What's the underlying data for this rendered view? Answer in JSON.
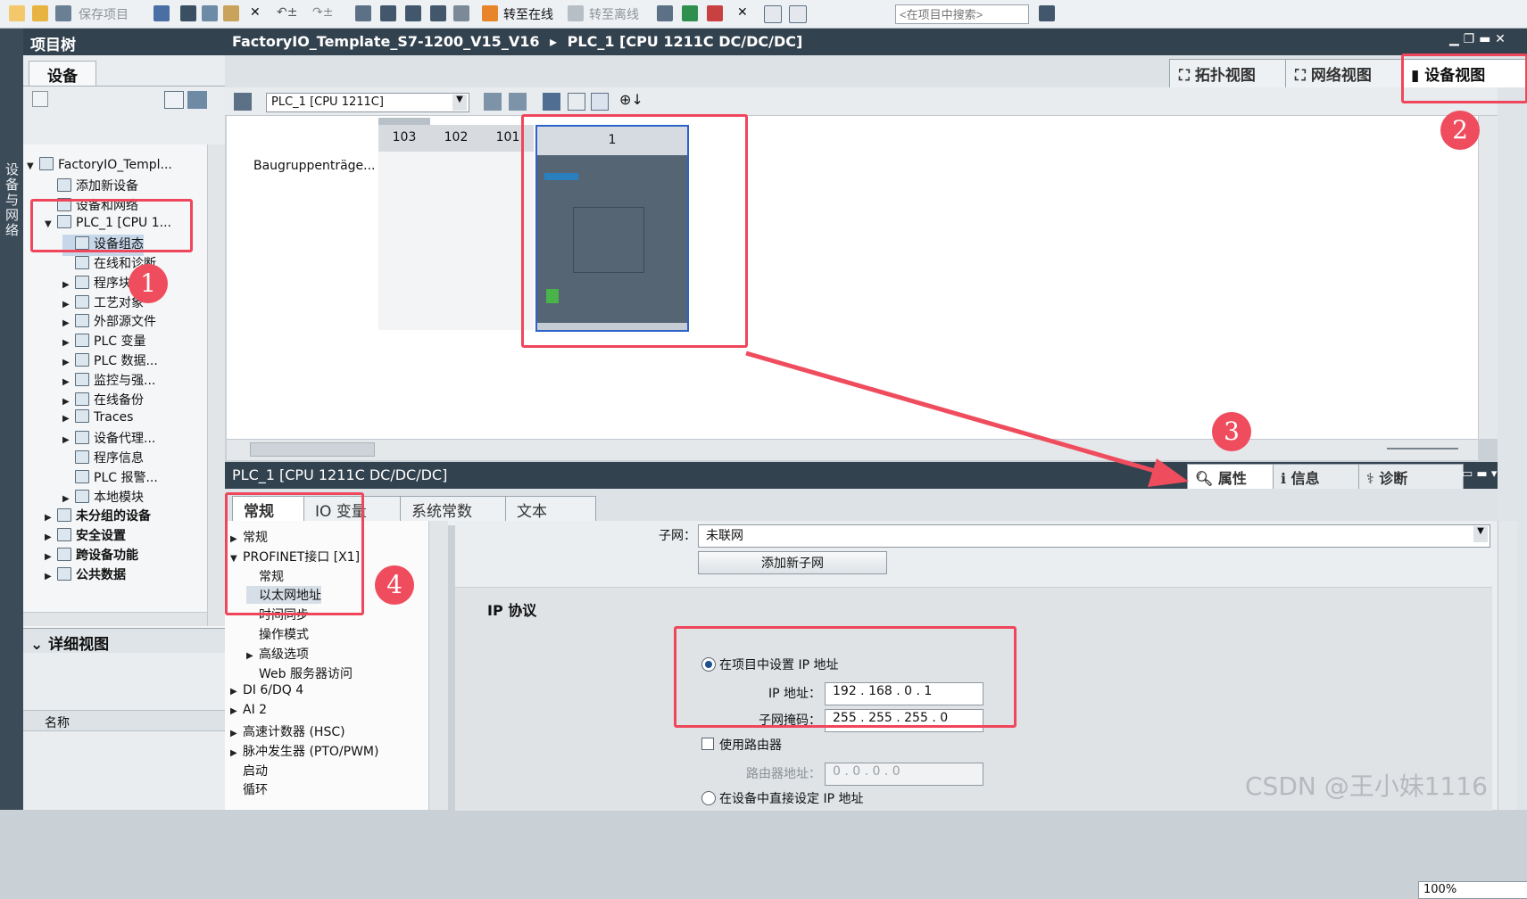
{
  "toolbar": {
    "save_project": "保存项目",
    "go_online": "转至在线",
    "go_offline": "转至离线",
    "search_placeholder": "<在项目中搜索>"
  },
  "left_strip": {
    "label": "设备与网络"
  },
  "tree": {
    "header": "项目树",
    "tab": "设备",
    "items": [
      {
        "label": "FactoryIO_Templ...",
        "indent": 0,
        "expand": "open"
      },
      {
        "label": "添加新设备",
        "indent": 1,
        "expand": "none"
      },
      {
        "label": "设备和网络",
        "indent": 1,
        "expand": "none"
      },
      {
        "label": "PLC_1 [CPU 1...",
        "indent": 1,
        "expand": "open"
      },
      {
        "label": "设备组态",
        "indent": 2,
        "expand": "none"
      },
      {
        "label": "在线和诊断",
        "indent": 2,
        "expand": "none"
      },
      {
        "label": "程序块",
        "indent": 2,
        "expand": "closed"
      },
      {
        "label": "工艺对象",
        "indent": 2,
        "expand": "closed"
      },
      {
        "label": "外部源文件",
        "indent": 2,
        "expand": "closed"
      },
      {
        "label": "PLC 变量",
        "indent": 2,
        "expand": "closed"
      },
      {
        "label": "PLC 数据...",
        "indent": 2,
        "expand": "closed"
      },
      {
        "label": "监控与强...",
        "indent": 2,
        "expand": "closed"
      },
      {
        "label": "在线备份",
        "indent": 2,
        "expand": "closed"
      },
      {
        "label": "Traces",
        "indent": 2,
        "expand": "closed"
      },
      {
        "label": "设备代理...",
        "indent": 2,
        "expand": "closed"
      },
      {
        "label": "程序信息",
        "indent": 2,
        "expand": "none"
      },
      {
        "label": "PLC 报警...",
        "indent": 2,
        "expand": "none"
      },
      {
        "label": "本地模块",
        "indent": 2,
        "expand": "closed"
      },
      {
        "label": "未分组的设备",
        "indent": 1,
        "expand": "closed"
      },
      {
        "label": "安全设置",
        "indent": 1,
        "expand": "closed"
      },
      {
        "label": "跨设备功能",
        "indent": 1,
        "expand": "closed"
      },
      {
        "label": "公共数据",
        "indent": 1,
        "expand": "closed"
      }
    ]
  },
  "detail": {
    "header": "详细视图",
    "col_name": "名称"
  },
  "main": {
    "breadcrumb_project": "FactoryIO_Template_S7-1200_V15_V16",
    "breadcrumb_sep": "▸",
    "breadcrumb_device": "PLC_1 [CPU 1211C DC/DC/DC]",
    "tabs": {
      "topology": "拓扑视图",
      "network": "网络视图",
      "device": "设备视图"
    },
    "device_select": "PLC_1 [CPU 1211C]",
    "rack_label": "Baugruppenträge...",
    "slots": [
      "103",
      "102",
      "101",
      "1"
    ],
    "zoom": "100%"
  },
  "inspector": {
    "title": "PLC_1 [CPU 1211C DC/DC/DC]",
    "tabs": {
      "properties": "属性",
      "info": "信息",
      "diagnostics": "诊断"
    },
    "prop_tabs": [
      "常规",
      "IO 变量",
      "系统常数",
      "文本"
    ],
    "nav": [
      {
        "label": "常规",
        "indent": 0,
        "expand": "closed"
      },
      {
        "label": "PROFINET接口 [X1]",
        "indent": 0,
        "expand": "open"
      },
      {
        "label": "常规",
        "indent": 1,
        "expand": "none"
      },
      {
        "label": "以太网地址",
        "indent": 1,
        "expand": "none"
      },
      {
        "label": "时间同步",
        "indent": 1,
        "expand": "none"
      },
      {
        "label": "操作模式",
        "indent": 1,
        "expand": "none"
      },
      {
        "label": "高级选项",
        "indent": 1,
        "expand": "closed"
      },
      {
        "label": "Web 服务器访问",
        "indent": 1,
        "expand": "none"
      },
      {
        "label": "DI 6/DQ 4",
        "indent": 0,
        "expand": "closed"
      },
      {
        "label": "AI 2",
        "indent": 0,
        "expand": "closed"
      },
      {
        "label": "高速计数器 (HSC)",
        "indent": 0,
        "expand": "closed"
      },
      {
        "label": "脉冲发生器 (PTO/PWM)",
        "indent": 0,
        "expand": "closed"
      },
      {
        "label": "启动",
        "indent": 0,
        "expand": "none"
      },
      {
        "label": "循环",
        "indent": 0,
        "expand": "none"
      }
    ],
    "form": {
      "subnet_label": "子网：",
      "subnet_value": "未联网",
      "add_subnet": "添加新子网",
      "ip_section": "IP 协议",
      "set_in_project": "在项目中设置 IP 地址",
      "ip_label": "IP 地址：",
      "ip_value": "192 . 168 . 0    . 1",
      "mask_label": "子网掩码：",
      "mask_value": "255 . 255 . 255 . 0",
      "use_router": "使用路由器",
      "router_label": "路由器地址：",
      "router_value": "0    . 0    . 0    . 0",
      "set_on_device": "在设备中直接设定 IP 地址"
    }
  },
  "annotations": [
    "1",
    "2",
    "3",
    "4"
  ],
  "watermark": "CSDN @王小妹1116",
  "colors": {
    "highlight": "#f0465c",
    "header": "#33424f",
    "accent": "#2c63c8"
  }
}
